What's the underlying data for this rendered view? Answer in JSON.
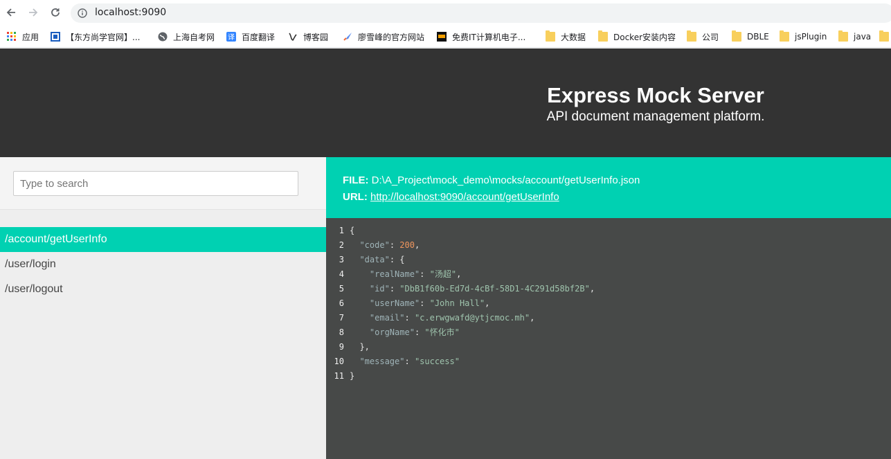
{
  "browser": {
    "url": "localhost:9090"
  },
  "bookmarks": [
    {
      "label": "应用",
      "icon": "apps-grid-icon"
    },
    {
      "label": "【东方尚学官网】...",
      "icon": "site-icon"
    },
    {
      "label": "上海自考网",
      "icon": "globe-icon"
    },
    {
      "label": "百度翻译",
      "icon": "translate-icon"
    },
    {
      "label": "博客园",
      "icon": "blog-icon"
    },
    {
      "label": "廖雪峰的官方网站",
      "icon": "rocket-icon"
    },
    {
      "label": "免费IT计算机电子...",
      "icon": "book-icon"
    },
    {
      "label": "大数据",
      "icon": "folder-icon"
    },
    {
      "label": "Docker安装内容",
      "icon": "folder-icon"
    },
    {
      "label": "公司",
      "icon": "folder-icon"
    },
    {
      "label": "DBLE",
      "icon": "folder-icon"
    },
    {
      "label": "jsPlugin",
      "icon": "folder-icon"
    },
    {
      "label": "java",
      "icon": "folder-icon"
    }
  ],
  "hero": {
    "title": "Express Mock Server",
    "subtitle": "API document management platform."
  },
  "sidebar": {
    "search_placeholder": "Type to search",
    "routes": [
      "/account/getUserInfo",
      "/user/login",
      "/user/logout"
    ],
    "active_index": 0
  },
  "file": {
    "file_label": "FILE:",
    "file_path": "D:\\A_Project\\mock_demo\\mocks/account/getUserInfo.json",
    "url_label": "URL:",
    "url": "http://localhost:9090/account/getUserInfo"
  },
  "code": {
    "line_numbers": [
      "1",
      "2",
      "3",
      "4",
      "5",
      "6",
      "7",
      "8",
      "9",
      "10",
      "11"
    ],
    "open_brace": "{",
    "code_key": "\"code\"",
    "code_value": "200",
    "data_key": "\"data\"",
    "realName_key": "\"realName\"",
    "realName_value": "\"汤超\"",
    "id_key": "\"id\"",
    "id_value": "\"DbB1f60b-Ed7d-4cBf-58D1-4C291d58bf2B\"",
    "userName_key": "\"userName\"",
    "userName_value": "\"John Hall\"",
    "email_key": "\"email\"",
    "email_value": "\"c.erwgwafd@ytjcmoc.mh\"",
    "orgName_key": "\"orgName\"",
    "orgName_value": "\"怀化市\"",
    "message_key": "\"message\"",
    "message_value": "\"success\"",
    "close_brace": "}"
  },
  "colors": {
    "accent": "#00d1b2",
    "hero_bg": "#333333",
    "code_bg": "#474948"
  }
}
